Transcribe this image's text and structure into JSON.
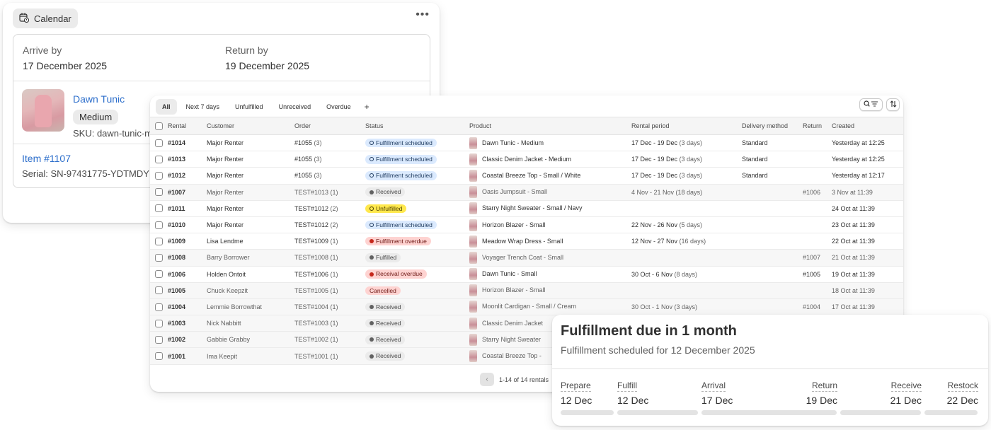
{
  "calendar": {
    "tab_label": "Calendar",
    "arrive_label": "Arrive by",
    "arrive_value": "17 December 2025",
    "return_label": "Return by",
    "return_value": "19 December 2025",
    "product_name": "Dawn Tunic",
    "size": "Medium",
    "sku": "SKU: dawn-tunic-m",
    "item_link": "Item #1107",
    "serial": "Serial: SN-97431775-YDTMDY"
  },
  "filters": {
    "tabs": [
      "All",
      "Next 7 days",
      "Unfulfilled",
      "Unreceived",
      "Overdue"
    ],
    "active": "All"
  },
  "table": {
    "headers": [
      "Rental",
      "Customer",
      "Order",
      "Status",
      "Product",
      "Rental period",
      "Delivery method",
      "Return",
      "Created"
    ],
    "rows": [
      {
        "rental": "#1014",
        "customer": "Major Renter",
        "order": "#1055",
        "order_qty": "(3)",
        "status": "Fulfillment scheduled",
        "tone": "info",
        "product": "Dawn Tunic - Medium",
        "period": "17 Dec - 19 Dec",
        "period_days": "(3 days)",
        "delivery": "Standard",
        "return": "",
        "created": "Yesterday at 12:25",
        "dim": false
      },
      {
        "rental": "#1013",
        "customer": "Major Renter",
        "order": "#1055",
        "order_qty": "(3)",
        "status": "Fulfillment scheduled",
        "tone": "info",
        "product": "Classic Denim Jacket - Medium",
        "period": "17 Dec - 19 Dec",
        "period_days": "(3 days)",
        "delivery": "Standard",
        "return": "",
        "created": "Yesterday at 12:25",
        "dim": false
      },
      {
        "rental": "#1012",
        "customer": "Major Renter",
        "order": "#1055",
        "order_qty": "(3)",
        "status": "Fulfillment scheduled",
        "tone": "info",
        "product": "Coastal Breeze Top - Small / White",
        "period": "17 Dec - 19 Dec",
        "period_days": "(3 days)",
        "delivery": "Standard",
        "return": "",
        "created": "Yesterday at 12:17",
        "dim": false
      },
      {
        "rental": "#1007",
        "customer": "Major Renter",
        "order": "TEST#1013",
        "order_qty": "(1)",
        "status": "Received",
        "tone": "neutral",
        "product": "Oasis Jumpsuit - Small",
        "period": "4 Nov - 21 Nov",
        "period_days": "(18 days)",
        "delivery": "",
        "return": "#1006",
        "created": "3 Nov at 11:39",
        "dim": true
      },
      {
        "rental": "#1011",
        "customer": "Major Renter",
        "order": "TEST#1012",
        "order_qty": "(2)",
        "status": "Unfulfilled",
        "tone": "warn",
        "product": "Starry Night Sweater - Small / Navy",
        "period": "",
        "period_days": "",
        "delivery": "",
        "return": "",
        "created": "24 Oct at 11:39",
        "dim": false
      },
      {
        "rental": "#1010",
        "customer": "Major Renter",
        "order": "TEST#1012",
        "order_qty": "(2)",
        "status": "Fulfillment scheduled",
        "tone": "info",
        "product": "Horizon Blazer - Small",
        "period": "22 Nov - 26 Nov",
        "period_days": "(5 days)",
        "delivery": "",
        "return": "",
        "created": "23 Oct at 11:39",
        "dim": false
      },
      {
        "rental": "#1009",
        "customer": "Lisa Lendme",
        "order": "TEST#1009",
        "order_qty": "(1)",
        "status": "Fulfillment overdue",
        "tone": "crit",
        "product": "Meadow Wrap Dress - Small",
        "period": "12 Nov - 27 Nov",
        "period_days": "(16 days)",
        "delivery": "",
        "return": "",
        "created": "22 Oct at 11:39",
        "dim": false
      },
      {
        "rental": "#1008",
        "customer": "Barry Borrower",
        "order": "TEST#1008",
        "order_qty": "(1)",
        "status": "Fulfilled",
        "tone": "neutral",
        "product": "Voyager Trench Coat - Small",
        "period": "",
        "period_days": "",
        "delivery": "",
        "return": "#1007",
        "created": "21 Oct at 11:39",
        "dim": true
      },
      {
        "rental": "#1006",
        "customer": "Holden Ontoit",
        "order": "TEST#1006",
        "order_qty": "(1)",
        "status": "Receival overdue",
        "tone": "crit",
        "product": "Dawn Tunic - Small",
        "period": "30 Oct - 6 Nov",
        "period_days": "(8 days)",
        "delivery": "",
        "return": "#1005",
        "created": "19 Oct at 11:39",
        "dim": false
      },
      {
        "rental": "#1005",
        "customer": "Chuck Keepzit",
        "order": "TEST#1005",
        "order_qty": "(1)",
        "status": "Cancelled",
        "tone": "crit-plain",
        "product": "Horizon Blazer - Small",
        "period": "",
        "period_days": "",
        "delivery": "",
        "return": "",
        "created": "18 Oct at 11:39",
        "dim": true
      },
      {
        "rental": "#1004",
        "customer": "Lemmie Borrowthat",
        "order": "TEST#1004",
        "order_qty": "(1)",
        "status": "Received",
        "tone": "neutral",
        "product": "Moonlit Cardigan - Small / Cream",
        "period": "30 Oct - 1 Nov",
        "period_days": "(3 days)",
        "delivery": "",
        "return": "#1004",
        "created": "17 Oct at 11:39",
        "dim": true
      },
      {
        "rental": "#1003",
        "customer": "Nick Nabbitt",
        "order": "TEST#1003",
        "order_qty": "(1)",
        "status": "Received",
        "tone": "neutral",
        "product": "Classic Denim Jacket",
        "period": "",
        "period_days": "",
        "delivery": "",
        "return": "",
        "created": "",
        "dim": true
      },
      {
        "rental": "#1002",
        "customer": "Gabbie Grabby",
        "order": "TEST#1002",
        "order_qty": "(1)",
        "status": "Received",
        "tone": "neutral",
        "product": "Starry Night Sweater",
        "period": "",
        "period_days": "",
        "delivery": "",
        "return": "",
        "created": "",
        "dim": true
      },
      {
        "rental": "#1001",
        "customer": "Ima Keepit",
        "order": "TEST#1001",
        "order_qty": "(1)",
        "status": "Received",
        "tone": "neutral",
        "product": "Coastal Breeze Top -",
        "period": "",
        "period_days": "",
        "delivery": "",
        "return": "",
        "created": "",
        "dim": true
      }
    ],
    "pagination": "1-14 of 14 rentals"
  },
  "fulfillment": {
    "title": "Fulfillment due in 1 month",
    "subtitle": "Fulfillment scheduled for 12 December 2025",
    "steps": [
      {
        "label": "Prepare",
        "date": "12 Dec"
      },
      {
        "label": "Fulfill",
        "date": "12 Dec"
      },
      {
        "label": "Arrival",
        "date": "17 Dec"
      },
      {
        "label": "Return",
        "date": "19 Dec"
      },
      {
        "label": "Receive",
        "date": "21 Dec"
      },
      {
        "label": "Restock",
        "date": "22 Dec"
      }
    ]
  },
  "colors": {
    "link": "#2c6ecb",
    "info_badge": "#dbeafe",
    "warn_badge": "#ffe84d",
    "crit_badge": "#fed3d1",
    "neutral_badge": "#ebebeb"
  },
  "icons": [
    "calendar-icon",
    "more-horizontal-icon",
    "search-filter-icon",
    "sort-icon",
    "plus-icon",
    "chevron-left-icon"
  ]
}
